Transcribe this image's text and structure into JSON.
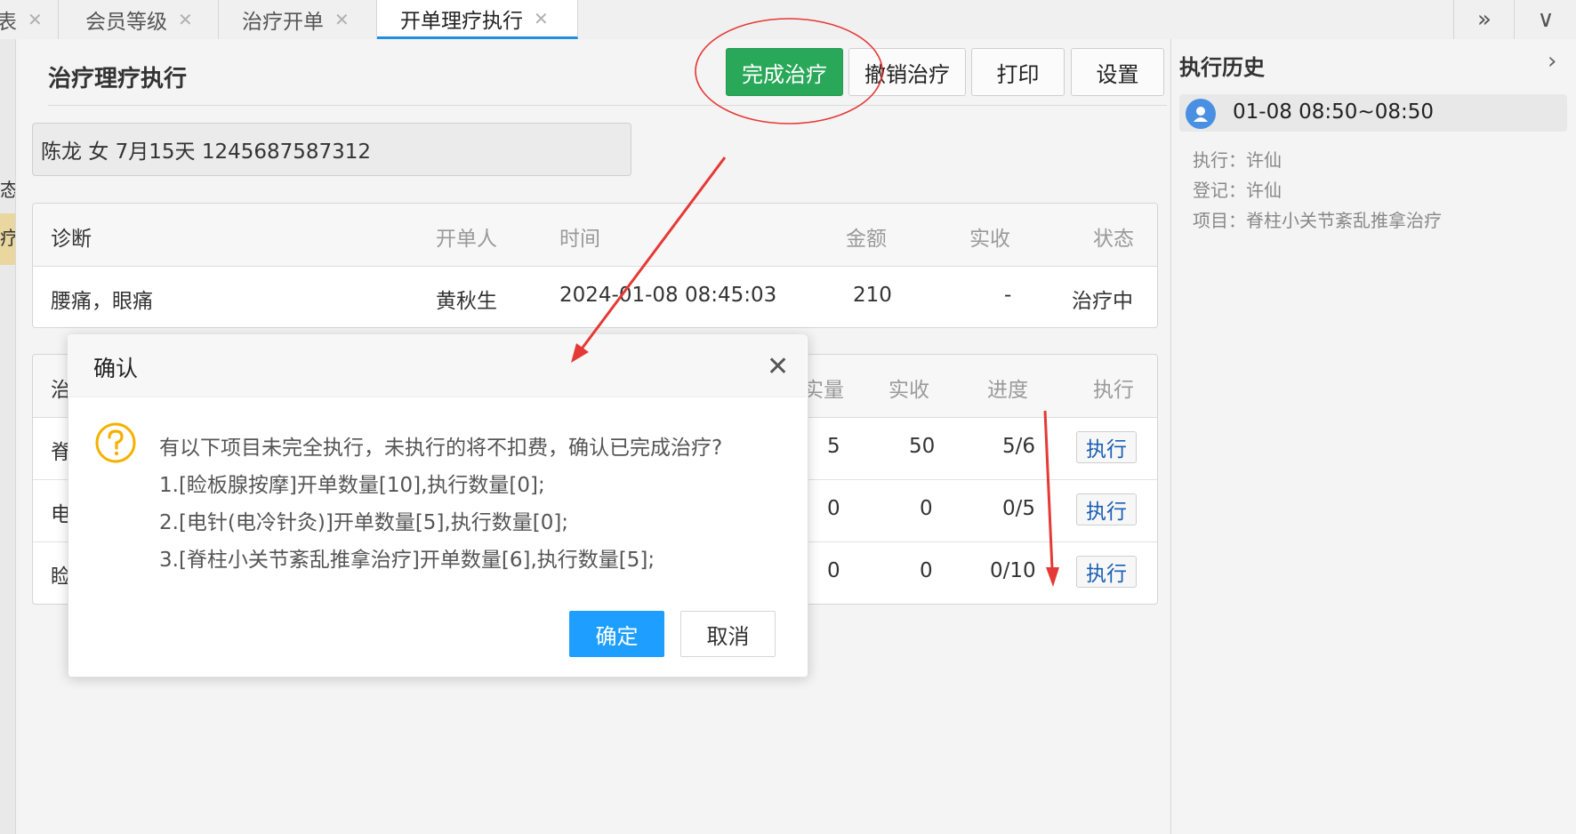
{
  "tabs": [
    {
      "label": "表"
    },
    {
      "label": "会员等级"
    },
    {
      "label": "治疗开单"
    },
    {
      "label": "开单理疗执行",
      "active": true
    }
  ],
  "tabbar_icons": {
    "more": "»",
    "dropdown": "∨"
  },
  "left_strip": {
    "item1": "态",
    "item2": "疗"
  },
  "page": {
    "title": "治疗理疗执行"
  },
  "toolbar": {
    "complete_label": "完成治疗",
    "revoke_label": "撤销治疗",
    "print_label": "打印",
    "settings_label": "设置"
  },
  "patient": {
    "info": "陈龙  女  7月15天  1245687587312"
  },
  "diagnosis_table": {
    "headers": {
      "diagnosis": "诊断",
      "doctor": "开单人",
      "time": "时间",
      "amount": "金额",
      "received": "实收",
      "status": "状态"
    },
    "row": {
      "diagnosis": "腰痛，眼痛",
      "doctor": "黄秋生",
      "time": "2024-01-08 08:45:03",
      "amount": "210",
      "received": "-",
      "status": "治疗中"
    }
  },
  "items_table": {
    "headers": {
      "name": "治",
      "qty": "实量",
      "received": "实收",
      "progress": "进度",
      "exec": "执行"
    },
    "rows": [
      {
        "name": "脊",
        "qty": "5",
        "received": "50",
        "progress": "5/6",
        "exec": "执行"
      },
      {
        "name": "电",
        "qty": "0",
        "received": "0",
        "progress": "0/5",
        "exec": "执行"
      },
      {
        "name": "睑",
        "qty": "0",
        "received": "0",
        "progress": "0/10",
        "exec": "执行"
      }
    ]
  },
  "history": {
    "title": "执行历史",
    "time": "01-08 08:50~08:50",
    "executor": "执行：许仙",
    "registrar": "登记：许仙",
    "item": "项目：脊柱小关节紊乱推拿治疗"
  },
  "modal": {
    "title": "确认",
    "message": "有以下项目未完全执行，未执行的将不扣费，确认已完成治疗?",
    "line1": "1.[睑板腺按摩]开单数量[10],执行数量[0];",
    "line2": "2.[电针(电冷针灸)]开单数量[5],执行数量[0];",
    "line3": "3.[脊柱小关节紊乱推拿治疗]开单数量[6],执行数量[5];",
    "ok_label": "确定",
    "cancel_label": "取消"
  },
  "colors": {
    "primary": "#1e9fff",
    "success": "#2aa85a",
    "active_tab": "#1f8fdd",
    "annotation": "#e53935"
  }
}
